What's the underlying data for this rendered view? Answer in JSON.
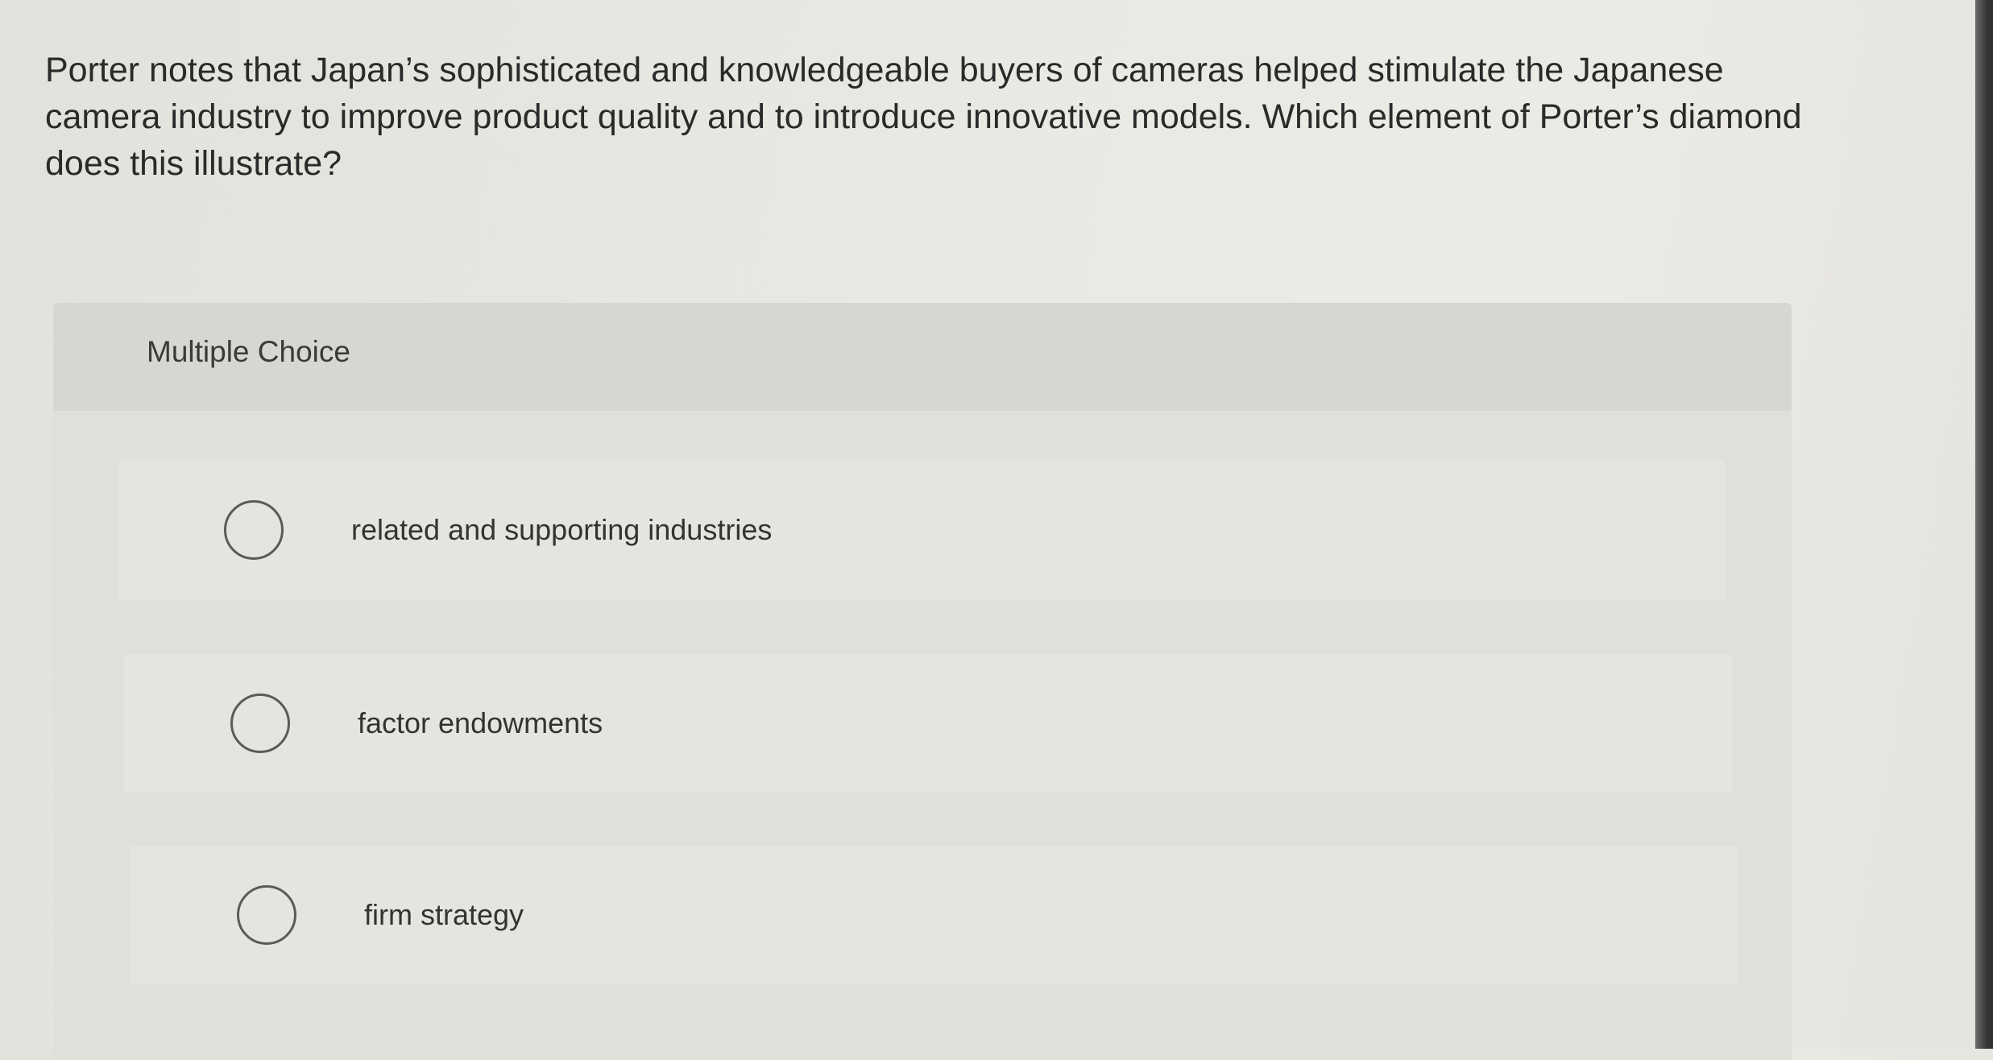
{
  "question": {
    "text": "Porter notes that Japan’s sophisticated and knowledgeable buyers of cameras helped stimulate the Japanese camera industry to improve product quality and to introduce innovative models. Which element of Porter’s diamond does this illustrate?"
  },
  "multiple_choice": {
    "label": "Multiple Choice",
    "options": [
      {
        "label": "related and supporting industries",
        "selected": false
      },
      {
        "label": "factor endowments",
        "selected": false
      },
      {
        "label": "firm strategy",
        "selected": false
      }
    ]
  }
}
